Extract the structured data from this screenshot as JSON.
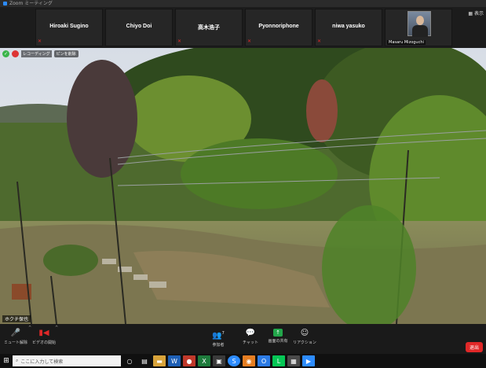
{
  "window": {
    "title": "Zoom ミーティング"
  },
  "participants": [
    {
      "name": "Hiroaki Sugino",
      "muted": true
    },
    {
      "name": "Chiyo Doi",
      "muted": false
    },
    {
      "name": "高木浩子",
      "muted": true
    },
    {
      "name": "Pyonnoriphone",
      "muted": true
    },
    {
      "name": "niwa yasuko",
      "muted": true
    },
    {
      "name": "Masaru Mizoguchi",
      "video": true
    }
  ],
  "view_toggle": "表示",
  "main_video": {
    "recording_text": "レコーディング",
    "pinned_text": "ピンを削除",
    "speaker_name": "ホクチ保也"
  },
  "toolbar": {
    "mute_label": "ミュート解除",
    "video_label": "ビデオの開始",
    "participants_label": "参加者",
    "participants_count": "7",
    "chat_label": "チャット",
    "share_label": "画面の共有",
    "reactions_label": "リアクション",
    "end_label": "退出"
  },
  "taskbar": {
    "search_placeholder": "ここに入力して検索"
  },
  "colors": {
    "accent": "#2d8cff",
    "danger": "#e02828",
    "share_green": "#22a64a"
  }
}
